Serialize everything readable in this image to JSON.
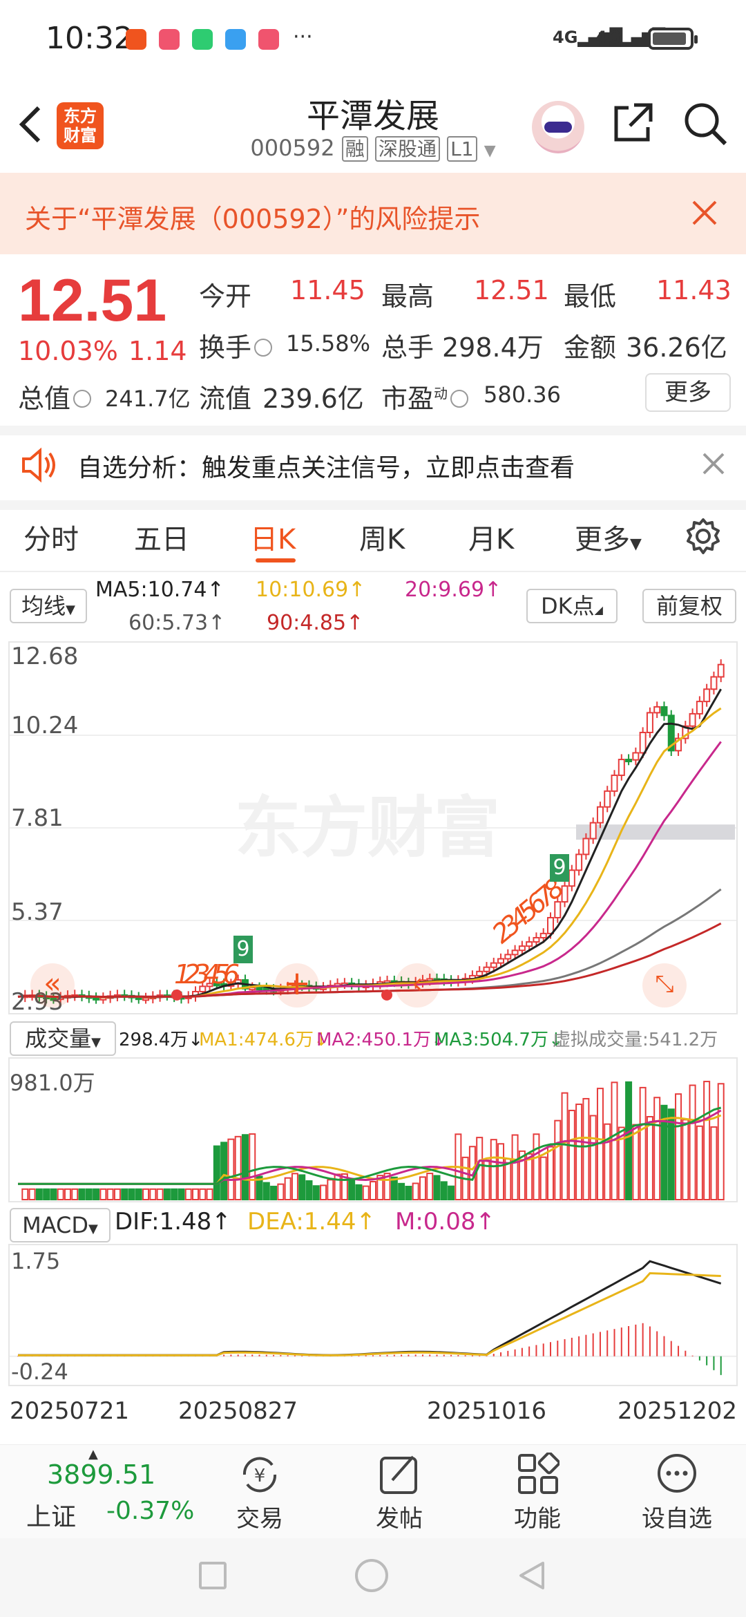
{
  "status_bar": {
    "time": "10:32",
    "signal1": "4G",
    "signal2": "4G"
  },
  "header": {
    "title": "平潭发展",
    "code": "000592",
    "tags": [
      "融",
      "深股通",
      "L1"
    ],
    "logo_text": [
      "东方",
      "财富"
    ]
  },
  "risk_banner": {
    "text": "关于“平潭发展（000592）”的风险提示"
  },
  "quote": {
    "price": "12.51",
    "change_pct": "10.03%",
    "change": "1.14",
    "open_label": "今开",
    "open": "11.45",
    "high_label": "最高",
    "high": "12.51",
    "low_label": "最低",
    "low": "11.43",
    "turnover_label": "换手",
    "turnover": "15.58%",
    "volume_label": "总手",
    "volume": "298.4万",
    "amount_label": "金额",
    "amount": "36.26亿",
    "mktcap_label": "总值",
    "mktcap": "241.7亿",
    "float_label": "流值",
    "float": "239.6亿",
    "pe_label": "市盈",
    "pe_sup": "动",
    "pe": "580.36",
    "more_button": "更多"
  },
  "analysis_banner": {
    "text": "自选分析：触发重点关注信号，立即点击查看"
  },
  "tabs": [
    {
      "label": "分时"
    },
    {
      "label": "五日"
    },
    {
      "label": "日K"
    },
    {
      "label": "周K"
    },
    {
      "label": "月K"
    },
    {
      "label": "更多"
    }
  ],
  "ma_legend": {
    "selector": "均线",
    "ma5": "MA5:10.74↑",
    "ma10": "10:10.69↑",
    "ma20": "20:9.69↑",
    "ma60": "60:5.73↑",
    "ma90": "90:4.85↑",
    "dk_button": "DK点",
    "adjust_button": "前复权"
  },
  "kline": {
    "watermark": "东方财富",
    "y_labels": [
      "12.68",
      "10.24",
      "7.81",
      "5.37",
      "2.93"
    ],
    "signal_9a": "9",
    "signal_9b": "9",
    "signal_seq_a": "123456",
    "signal_seq_b": "2345678"
  },
  "volume": {
    "selector": "成交量",
    "value": "298.4万↓",
    "ma1": "MA1:474.6万↓",
    "ma2": "MA2:450.1万↓",
    "ma3": "MA3:504.7万↓",
    "virtual": "虚拟成交量:541.2万",
    "y_max": "981.0万"
  },
  "macd": {
    "selector": "MACD",
    "dif": "DIF:1.48↑",
    "dea": "DEA:1.44↑",
    "m": "M:0.08↑",
    "y_max": "1.75",
    "y_min": "-0.24"
  },
  "dates": [
    "20250721",
    "20250827",
    "20251016",
    "20251202"
  ],
  "bottom_nav": {
    "index_value": "3899.51",
    "index_name": "上证",
    "index_change": "-0.37%",
    "items": [
      {
        "label": "交易"
      },
      {
        "label": "发帖"
      },
      {
        "label": "功能"
      },
      {
        "label": "设自选"
      }
    ]
  },
  "colors": {
    "up": "#e63c3c",
    "down": "#1d9a3c",
    "accent": "#f0541e",
    "ma5": "#222222",
    "ma10": "#e8b418",
    "ma20": "#c8288c",
    "ma60": "#777777",
    "ma90": "#c42828"
  }
}
